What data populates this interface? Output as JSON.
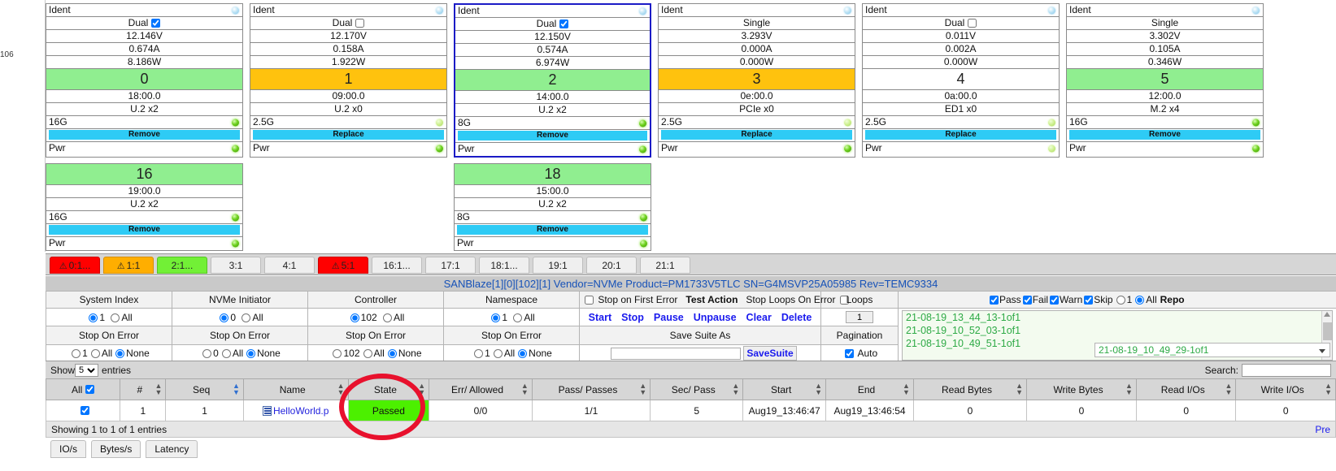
{
  "gutter": {
    "stamp": "106"
  },
  "cards": [
    {
      "ident_label": "Ident",
      "mode": "Dual",
      "mode_checked": true,
      "volts": "12.146V",
      "amps": "0.674A",
      "watts": "8.186W",
      "slot": "0",
      "slot_color": "green",
      "bdf": "18:00.0",
      "link": "U.2 x2",
      "speed": "16G",
      "action": "Remove",
      "pwr_label": "Pwr",
      "selected": false,
      "speed_led": "green",
      "pwr_led": "green",
      "ident_led": "blue"
    },
    {
      "ident_label": "Ident",
      "mode": "Dual",
      "mode_checked": false,
      "volts": "12.170V",
      "amps": "0.158A",
      "watts": "1.922W",
      "slot": "1",
      "slot_color": "amber",
      "bdf": "09:00.0",
      "link": "U.2 x0",
      "speed": "2.5G",
      "action": "Replace",
      "pwr_label": "Pwr",
      "selected": false,
      "speed_led": "paleg",
      "pwr_led": "green",
      "ident_led": "blue"
    },
    {
      "ident_label": "Ident",
      "mode": "Dual",
      "mode_checked": true,
      "volts": "12.150V",
      "amps": "0.574A",
      "watts": "6.974W",
      "slot": "2",
      "slot_color": "green",
      "bdf": "14:00.0",
      "link": "U.2 x2",
      "speed": "8G",
      "action": "Remove",
      "pwr_label": "Pwr",
      "selected": true,
      "speed_led": "green",
      "pwr_led": "green",
      "ident_led": "blue"
    },
    {
      "ident_label": "Ident",
      "mode": "Single",
      "mode_checked": null,
      "volts": "3.293V",
      "amps": "0.000A",
      "watts": "0.000W",
      "slot": "3",
      "slot_color": "amber",
      "bdf": "0e:00.0",
      "link": "PCIe x0",
      "speed": "2.5G",
      "action": "Replace",
      "pwr_label": "Pwr",
      "selected": false,
      "speed_led": "paleg",
      "pwr_led": "green",
      "ident_led": "blue"
    },
    {
      "ident_label": "Ident",
      "mode": "Dual",
      "mode_checked": false,
      "volts": "0.011V",
      "amps": "0.002A",
      "watts": "0.000W",
      "slot": "4",
      "slot_color": "white",
      "bdf": "0a:00.0",
      "link": "ED1 x0",
      "speed": "2.5G",
      "action": "Replace",
      "pwr_label": "Pwr",
      "selected": false,
      "speed_led": "paleg",
      "pwr_led": "paleg",
      "ident_led": "blue"
    },
    {
      "ident_label": "Ident",
      "mode": "Single",
      "mode_checked": null,
      "volts": "3.302V",
      "amps": "0.105A",
      "watts": "0.346W",
      "slot": "5",
      "slot_color": "green",
      "bdf": "12:00.0",
      "link": "M.2 x4",
      "speed": "16G",
      "action": "Remove",
      "pwr_label": "Pwr",
      "selected": false,
      "speed_led": "green",
      "pwr_led": "green",
      "ident_led": "blue"
    }
  ],
  "cards_row2": [
    {
      "slot": "16",
      "slot_color": "green",
      "bdf": "19:00.0",
      "link": "U.2 x2",
      "speed": "16G",
      "action": "Remove",
      "pwr_label": "Pwr",
      "speed_led": "green",
      "pwr_led": "green",
      "col": 0
    },
    {
      "slot": "18",
      "slot_color": "green",
      "bdf": "15:00.0",
      "link": "U.2 x2",
      "speed": "8G",
      "action": "Remove",
      "pwr_label": "Pwr",
      "speed_led": "green",
      "pwr_led": "green",
      "col": 2
    }
  ],
  "port_tabs": [
    {
      "label": "0:1...",
      "state": "red",
      "warn": true
    },
    {
      "label": "1:1",
      "state": "amber",
      "warn": true
    },
    {
      "label": "2:1...",
      "state": "green",
      "warn": false
    },
    {
      "label": "3:1",
      "state": "plain",
      "warn": false
    },
    {
      "label": "4:1",
      "state": "plain",
      "warn": false
    },
    {
      "label": "5:1",
      "state": "red",
      "warn": true
    },
    {
      "label": "16:1...",
      "state": "plain",
      "warn": false
    },
    {
      "label": "17:1",
      "state": "plain",
      "warn": false
    },
    {
      "label": "18:1...",
      "state": "plain",
      "warn": false
    },
    {
      "label": "19:1",
      "state": "plain",
      "warn": false
    },
    {
      "label": "20:1",
      "state": "plain",
      "warn": false
    },
    {
      "label": "21:1",
      "state": "plain",
      "warn": false
    }
  ],
  "device_title": "SANBlaze[1][0][102][1] Vendor=NVMe Product=PM1733V5TLC SN=G4MSVP25A05985 Rev=TEMC9334",
  "control": {
    "headers": [
      "System Index",
      "NVMe Initiator",
      "Controller",
      "Namespace"
    ],
    "selects": [
      {
        "value": "1",
        "value_selected": true,
        "all": "All"
      },
      {
        "value": "0",
        "value_selected": true,
        "all": "All"
      },
      {
        "value": "102",
        "value_selected": true,
        "all": "All"
      },
      {
        "value": "1",
        "value_selected": true,
        "all": "All"
      }
    ],
    "stop_on_error_label": "Stop On Error",
    "stop_on_error_rows": [
      {
        "value": "1",
        "all": "All",
        "none": "None",
        "selected": "none"
      },
      {
        "value": "0",
        "all": "All",
        "none": "None",
        "selected": "none"
      },
      {
        "value": "102",
        "all": "All",
        "none": "None",
        "selected": "none"
      },
      {
        "value": "1",
        "all": "All",
        "none": "None",
        "selected": "none"
      }
    ],
    "stop_first_error_label": "Stop on First Error",
    "stop_first_error_checked": false,
    "test_action_label": "Test Action",
    "stop_loops_label": "Stop Loops On Error",
    "stop_loops_checked": false,
    "actions": [
      "Start",
      "Stop",
      "Pause",
      "Unpause",
      "Clear",
      "Delete"
    ],
    "save_suite_as_label": "Save Suite As",
    "save_suite_input": "",
    "save_suite_button": "SaveSuite",
    "loops_label": "Loops",
    "loops_value": "1",
    "pagination_label": "Pagination",
    "auto_label": "Auto",
    "auto_checked": true,
    "filters": [
      {
        "label": "Pass",
        "checked": true
      },
      {
        "label": "Fail",
        "checked": true
      },
      {
        "label": "Warn",
        "checked": true
      },
      {
        "label": "Skip",
        "checked": true
      }
    ],
    "radio_one_label": "1",
    "radio_all_label": "All",
    "radio_all_selected": true,
    "reports_label": "Repo",
    "reports": [
      "21-08-19_13_44_13-1of1",
      "21-08-19_10_52_03-1of1",
      "21-08-19_10_49_51-1of1"
    ],
    "report_selected": "21-08-19_10_49_29-1of1"
  },
  "datatable": {
    "show_label": "Show",
    "show_value": "5",
    "entries_label": "entries",
    "search_label": "Search:",
    "search_value": "",
    "columns": [
      "All",
      "#",
      "Seq",
      "Name",
      "State",
      "Err/ Allowed",
      "Pass/ Passes",
      "Sec/ Pass",
      "Start",
      "End",
      "Read Bytes",
      "Write Bytes",
      "Read I/Os",
      "Write I/Os"
    ],
    "header_all_checked": true,
    "sorted_column": "Seq",
    "rows": [
      {
        "checked": true,
        "num": "1",
        "seq": "1",
        "name": "HelloWorld.p",
        "state": "Passed",
        "err_allowed": "0/0",
        "pass_passes": "1/1",
        "sec_pass": "5",
        "start": "Aug19_13:46:47",
        "end": "Aug19_13:46:54",
        "read_bytes": "0",
        "write_bytes": "0",
        "read_ios": "0",
        "write_ios": "0"
      }
    ],
    "footer_text": "Showing 1 to 1 of 1 entries",
    "footer_page": "Pre",
    "bottom_tabs": [
      "IO/s",
      "Bytes/s",
      "Latency"
    ]
  },
  "colors": {
    "green_header": "#90ee90",
    "amber_header": "#ffc20e",
    "action_button": "#2ecbf5",
    "pass_green": "#4cf000",
    "link_blue": "#1a1aee",
    "annotation_red": "#e8112d",
    "selected_border": "#1b1bc6"
  }
}
